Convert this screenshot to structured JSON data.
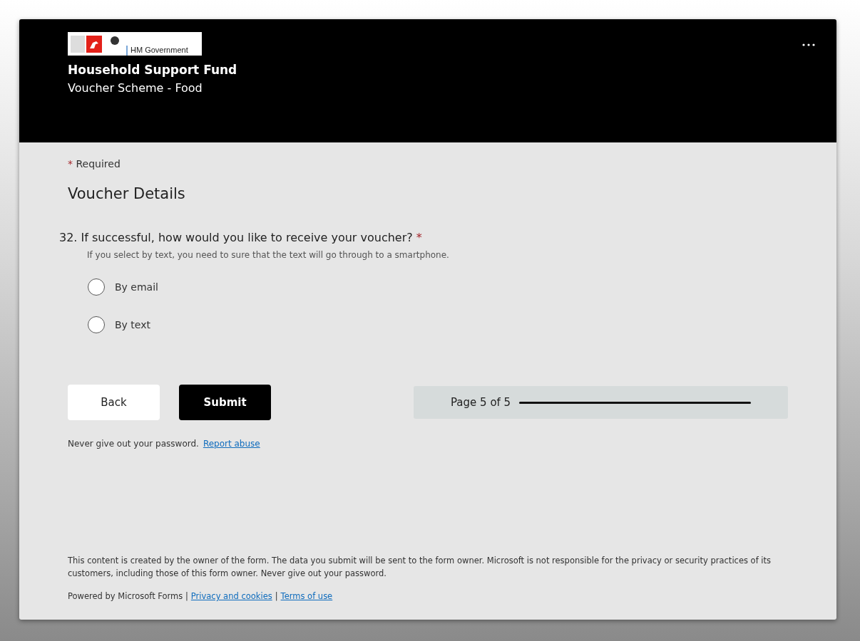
{
  "header": {
    "logo_text": "HM Government",
    "title": "Household Support Fund",
    "subtitle": "Voucher Scheme - Food"
  },
  "required_note": {
    "mark": "*",
    "label": "Required"
  },
  "section_title": "Voucher Details",
  "question": {
    "number": "32.",
    "text": "If successful, how would you like to receive your voucher?",
    "required": true,
    "hint": "If you select by text, you need to sure that the text will go through to a smartphone.",
    "options": [
      {
        "label": "By email",
        "selected": false
      },
      {
        "label": "By text",
        "selected": false
      }
    ]
  },
  "buttons": [
    {
      "label": "Back",
      "kind": "secondary"
    },
    {
      "label": "Submit",
      "kind": "primary"
    }
  ],
  "progress": {
    "label": "Page 5 of 5",
    "level": 1
  },
  "warning": {
    "text": "Never give out your password.",
    "link": "Report abuse"
  },
  "footer": {
    "disclaimer": "This content is created by the owner of the form. The data you submit will be sent to the form owner. Microsoft is not responsible for the privacy or security practices of its customers, including those of this form owner. Never give out your password.",
    "powered": "Powered by Microsoft Forms |",
    "links": [
      "Privacy and cookies",
      "Terms of use"
    ],
    "separator": "|"
  }
}
